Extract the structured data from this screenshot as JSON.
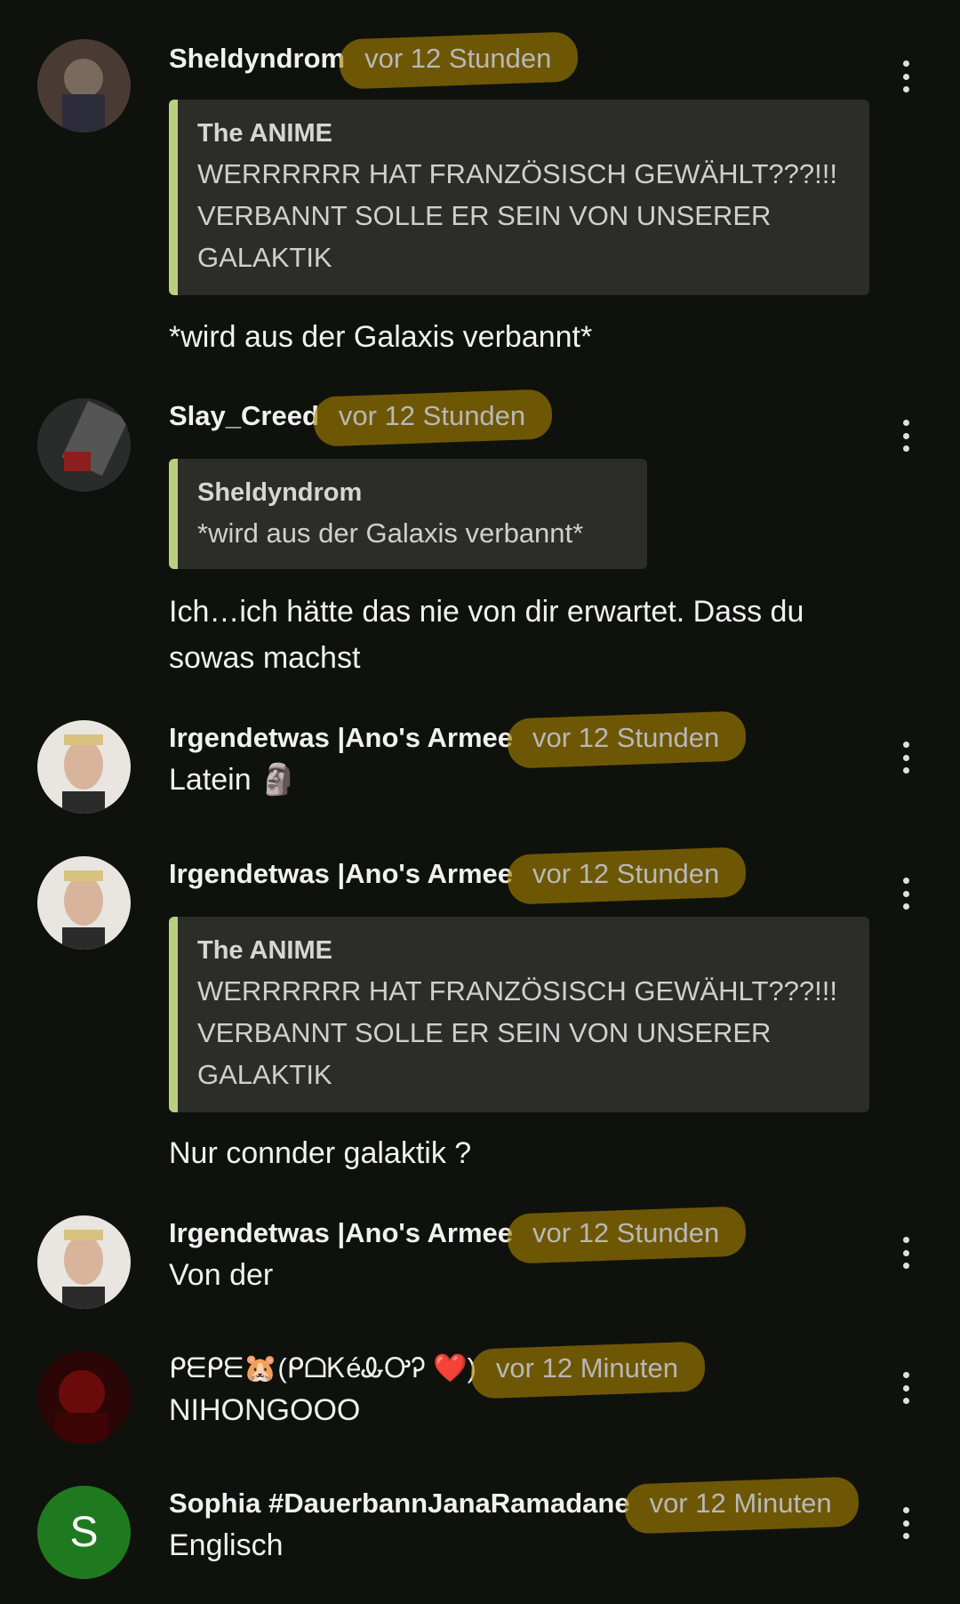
{
  "comments": [
    {
      "author": "Sheldyndrom",
      "time": "vor 12 Stunden",
      "quote_author": "The ANIME",
      "quote_text": "WERRRRRR HAT FRANZÖSISCH GEWÄHLT???!!! VERBANNT SOLLE ER SEIN VON UNSERER GALAKTIK",
      "text": "*wird aus der Galaxis verbannt*"
    },
    {
      "author": "Slay_Creed",
      "time": "vor 12 Stunden",
      "quote_author": "Sheldyndrom",
      "quote_text": "*wird aus der Galaxis verbannt*",
      "text": "Ich…ich hätte das nie von dir erwartet. Dass du sowas machst"
    },
    {
      "author": "Irgendetwas |Ano's Armee",
      "time": "vor 12 Stunden",
      "text": "Latein 🗿"
    },
    {
      "author": "Irgendetwas |Ano's Armee",
      "time": "vor 12 Stunden",
      "quote_author": "The ANIME",
      "quote_text": "WERRRRRR HAT FRANZÖSISCH GEWÄHLT???!!! VERBANNT SOLLE ER SEIN VON UNSERER GALAKTIK",
      "text": "Nur connder galaktik ?"
    },
    {
      "author": "Irgendetwas |Ano's Armee",
      "time": "vor 12 Stunden",
      "text": "Von der"
    },
    {
      "author": "ᑭᗴᑭᗴ🐹(ᑭᗝᏦéᎲᎤᎮ ❤️)",
      "time": "vor 12 Minuten",
      "text": "NIHONGOOO"
    },
    {
      "author": "Sophia #DauerbannJanaRamadane",
      "time": "vor 12 Minuten",
      "avatar_letter": "S",
      "text": "Englisch"
    }
  ],
  "colors": {
    "background": "#0f110d",
    "quote_bar": "#b9cf82",
    "highlight": "#aa8200",
    "avatar_green": "#1f7a1f"
  },
  "icons": [
    "more-vert-icon"
  ]
}
